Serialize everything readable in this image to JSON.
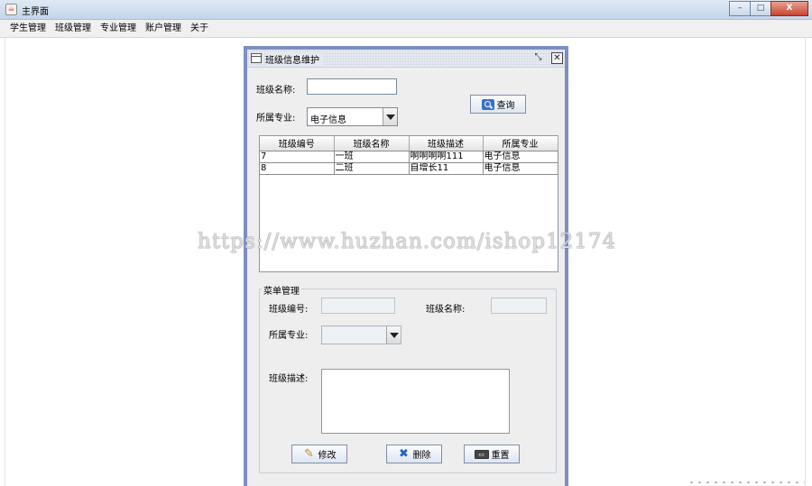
{
  "window": {
    "title": "主界面",
    "icon": "java-cup-icon",
    "controls": {
      "minimize": "–",
      "maximize": "□",
      "close": "X"
    }
  },
  "menubar": {
    "items": [
      "学生管理",
      "班级管理",
      "专业管理",
      "账户管理",
      "关于"
    ]
  },
  "dialog": {
    "title": "班级信息维护",
    "restore_glyph": "⤡",
    "close_glyph": "✕",
    "search": {
      "class_name_label": "班级名称:",
      "class_name_value": "",
      "major_label": "所属专业:",
      "major_selected": "电子信息",
      "query_button": "查询"
    },
    "table": {
      "columns": [
        "班级编号",
        "班级名称",
        "班级描述",
        "所属专业"
      ],
      "rows": [
        [
          "7",
          "一班",
          "啊啊啊啊111",
          "电子信息"
        ],
        [
          "8",
          "二班",
          "自增长11",
          "电子信息"
        ]
      ]
    },
    "edit": {
      "group_title": "菜单管理",
      "class_id_label": "班级编号:",
      "class_id_value": "",
      "class_name_label": "班级名称:",
      "class_name_value": "",
      "major_label": "所属专业:",
      "major_selected": "",
      "desc_label": "班级描述:",
      "desc_value": "",
      "modify_button": "修改",
      "delete_button": "删除",
      "reset_button": "重置"
    }
  },
  "watermark": "https://www.huzhan.com/ishop12174",
  "colors": {
    "frame_border": "#7b8fc3",
    "titlebar": "#c4d5ea",
    "close_button": "#c7452f",
    "panel_bg": "#eeeeee"
  }
}
